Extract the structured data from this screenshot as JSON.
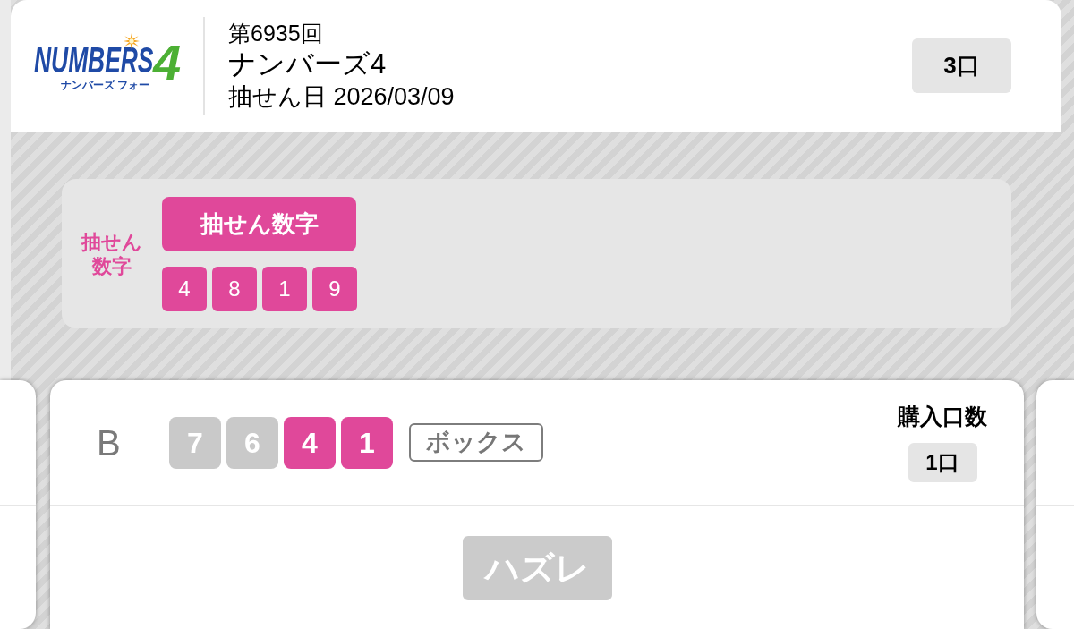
{
  "header": {
    "logo": {
      "wordmark": "NUMBERS",
      "digit": "4",
      "reading": "ナンバーズ フォー"
    },
    "round": "第6935回",
    "game": "ナンバーズ4",
    "draw_date": "抽せん日 2026/03/09",
    "ticket_count": "3口"
  },
  "winning_numbers": {
    "side_label": "抽せん数字",
    "title": "抽せん数字",
    "digits": [
      "4",
      "8",
      "1",
      "9"
    ]
  },
  "entries": [
    {
      "label": "B",
      "digits": [
        {
          "value": "7",
          "matched": false
        },
        {
          "value": "6",
          "matched": false
        },
        {
          "value": "4",
          "matched": true
        },
        {
          "value": "1",
          "matched": true
        }
      ],
      "play_type": "ボックス",
      "quantity_label": "購入口数",
      "quantity": "1口",
      "result": "ハズレ"
    }
  ]
}
